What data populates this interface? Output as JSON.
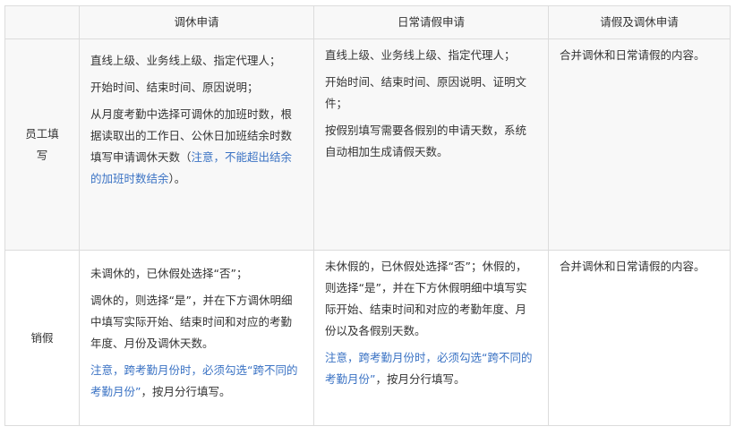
{
  "headers": [
    "",
    "调休申请",
    "日常请假申请",
    "请假及调休申请"
  ],
  "rows": [
    {
      "label": "员工填写",
      "col1": {
        "p1": "直线上级、业务线上级、指定代理人；",
        "p2": "开始时间、结束时间、原因说明；",
        "p3_black": "从月度考勤中选择可调休的加班时数，根据读取出的工作日、公休日加班结余时数填写申请调休天数（",
        "p3_blue": "注意，不能超出结余的加班时数结余",
        "p3_end": "）。"
      },
      "col2": {
        "p1": "直线上级、业务线上级、指定代理人；",
        "p2": "开始时间、结束时间、原因说明、证明文件；",
        "p3": "按假别填写需要各假别的申请天数，系统自动相加生成请假天数。"
      },
      "col3": "合并调休和日常请假的内容。"
    },
    {
      "label": "销假",
      "col1": {
        "p1": "未调休的，已休假处选择“否”；",
        "p2": "调休的，则选择“是”，并在下方调休明细中填写实际开始、结束时间和对应的考勤年度、月份及调休天数。",
        "p3_blue": "注意，跨考勤月份时，必须勾选“跨不同的考勤月份”",
        "p3_end": "，按月分行填写。"
      },
      "col2": {
        "p1": "未休假的，已休假处选择“否”；休假的，则选择“是”，并在下方休假明细中填写实际开始、结束时间和对应的考勤年度、月份以及各假别天数。",
        "p3_blue": "注意，跨考勤月份时，必须勾选“跨不同的考勤月份”",
        "p3_end": "，按月分行填写。"
      },
      "col3": "合并调休和日常请假的内容。"
    }
  ],
  "colors": {
    "border": "#dcdcdc",
    "header_bg": "#f8f8f8",
    "note_blue": "#3b73c4",
    "text": "#333333"
  }
}
